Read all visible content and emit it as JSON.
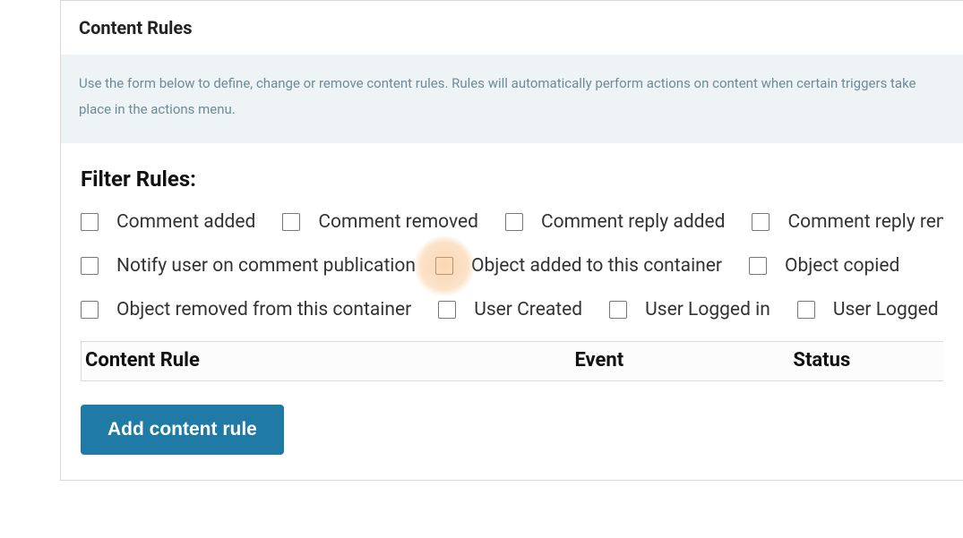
{
  "header": {
    "title": "Content Rules"
  },
  "info": {
    "text": "Use the form below to define, change or remove content rules. Rules will automatically perform actions on content when certain triggers take place in the actions menu."
  },
  "filter": {
    "heading": "Filter Rules:",
    "rows": [
      [
        {
          "label": "Comment added",
          "checked": false
        },
        {
          "label": "Comment removed",
          "checked": false
        },
        {
          "label": "Comment reply added",
          "checked": false
        },
        {
          "label": "Comment reply removed",
          "checked": false
        }
      ],
      [
        {
          "label": "Notify user on comment publication",
          "checked": false
        },
        {
          "label": "Object added to this container",
          "checked": false
        },
        {
          "label": "Object copied",
          "checked": false
        }
      ],
      [
        {
          "label": "Object removed from this container",
          "checked": false
        },
        {
          "label": "User Created",
          "checked": false
        },
        {
          "label": "User Logged in",
          "checked": false
        },
        {
          "label": "User Logged out",
          "checked": false
        }
      ]
    ]
  },
  "table": {
    "columns": {
      "rule": "Content Rule",
      "event": "Event",
      "status": "Status"
    },
    "rows": []
  },
  "actions": {
    "add_label": "Add content rule"
  },
  "highlight": {
    "target": "filter-checkbox-object-added-to-this-container"
  }
}
